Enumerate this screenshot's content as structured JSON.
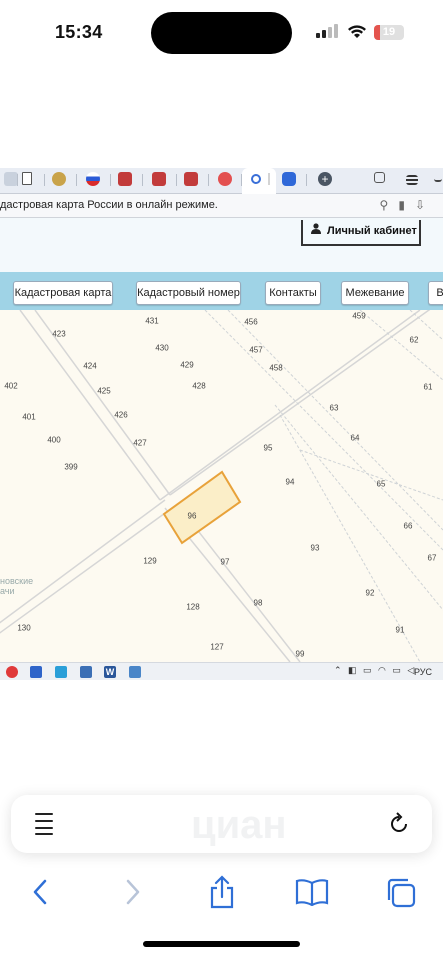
{
  "status": {
    "time": "15:34",
    "battery": "19",
    "battery_level": 0.19
  },
  "browser": {
    "address_text": "дастровая карта России в онлайн режиме."
  },
  "site": {
    "cabinet_label": "Личный кабинет",
    "nav": [
      {
        "label": "Кадастровая карта"
      },
      {
        "label": "Кадастровый номер"
      },
      {
        "label": "Контакты"
      },
      {
        "label": "Межевание"
      },
      {
        "label": "В"
      }
    ]
  },
  "map": {
    "plots": [
      "423",
      "431",
      "430",
      "456",
      "457",
      "459",
      "62",
      "402",
      "424",
      "429",
      "458",
      "401",
      "425",
      "428",
      "61",
      "63",
      "400",
      "426",
      "427",
      "64",
      "399",
      "95",
      "94",
      "65",
      "96",
      "66",
      "129",
      "97",
      "93",
      "67",
      "92",
      "128",
      "98",
      "130",
      "91",
      "127",
      "99"
    ],
    "highlighted_plot": "96",
    "highlight_color": "#e8a23a",
    "place_label": "новские\nачи"
  },
  "taskbar": {
    "lang": "РУС"
  },
  "safari": {
    "watermark": "циан"
  }
}
